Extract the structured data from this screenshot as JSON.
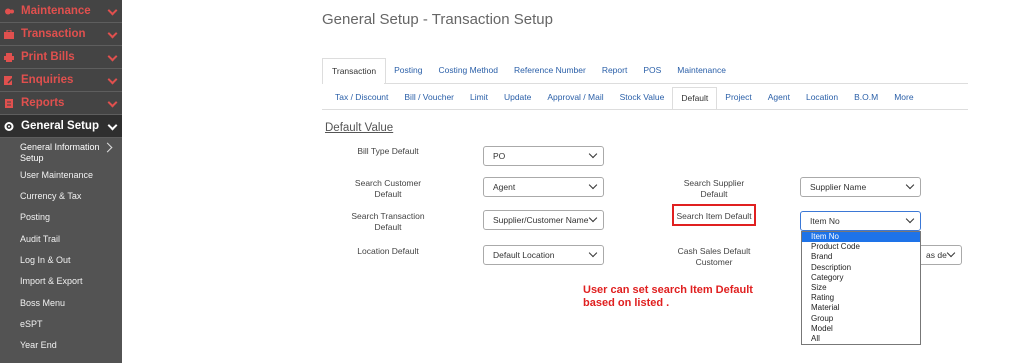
{
  "sidebar": {
    "menu": [
      {
        "label": "Maintenance",
        "icon": "cog-icon"
      },
      {
        "label": "Transaction",
        "icon": "cart-icon"
      },
      {
        "label": "Print Bills",
        "icon": "printer-icon"
      },
      {
        "label": "Enquiries",
        "icon": "edit-icon"
      },
      {
        "label": "Reports",
        "icon": "report-icon"
      },
      {
        "label": "General Setup",
        "icon": "gear-icon"
      }
    ],
    "sub_items": [
      "General Information Setup",
      "User Maintenance",
      "Currency & Tax",
      "Posting",
      "Audit Trail",
      "Log In & Out",
      "Import & Export",
      "Boss Menu",
      "eSPT",
      "Year End"
    ]
  },
  "page": {
    "title": "General Setup - Transaction Setup"
  },
  "tabs": [
    "Transaction",
    "Posting",
    "Costing Method",
    "Reference Number",
    "Report",
    "POS",
    "Maintenance"
  ],
  "subtabs": [
    "Tax / Discount",
    "Bill / Voucher",
    "Limit",
    "Update",
    "Approval / Mail",
    "Stock Value",
    "Default",
    "Project",
    "Agent",
    "Location",
    "B.O.M",
    "More"
  ],
  "section_title": "Default Value",
  "fields": {
    "bill_type": {
      "label": "Bill Type Default",
      "value": "PO"
    },
    "search_customer": {
      "label": "Search Customer Default",
      "value": "Agent"
    },
    "search_transaction": {
      "label": "Search Transaction Default",
      "value": "Supplier/Customer Name"
    },
    "location": {
      "label": "Location Default",
      "value": "Default Location"
    },
    "search_supplier": {
      "label": "Search Supplier Default",
      "value": "Supplier Name"
    },
    "search_item": {
      "label": "Search Item Default",
      "value": "Item No"
    },
    "cash_sales_customer": {
      "label": "Cash Sales Default Customer",
      "value": "as de"
    }
  },
  "dropdown_options": [
    "Item No",
    "Product Code",
    "Brand",
    "Description",
    "Category",
    "Size",
    "Rating",
    "Material",
    "Group",
    "Model",
    "All"
  ],
  "note": {
    "line1": "User can set search Item Default",
    "line2": "based on listed ."
  },
  "colors": {
    "accent_red": "#e0504e",
    "link_blue": "#2a5fa8",
    "selection_blue": "#1e73e8",
    "annotation_red": "#e02020"
  }
}
